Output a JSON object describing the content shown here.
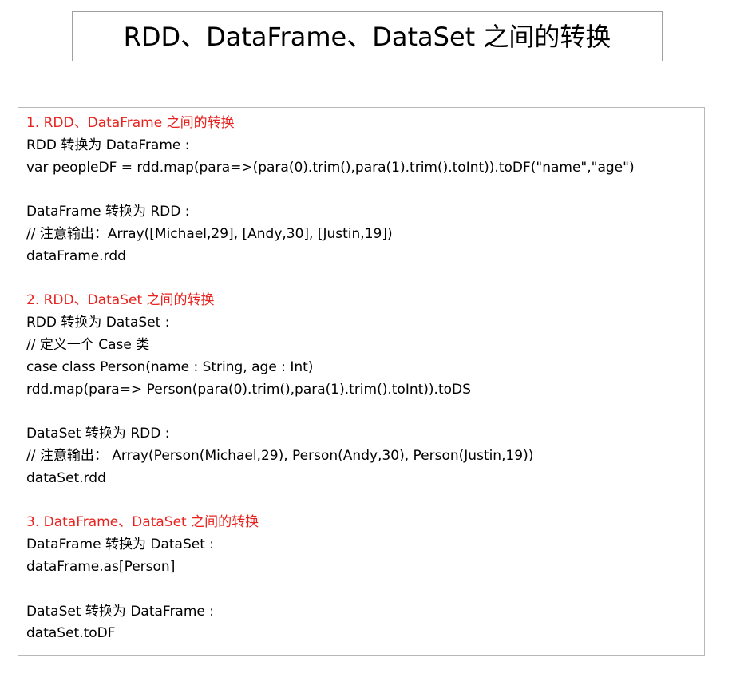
{
  "title": "RDD、DataFrame、DataSet 之间的转换",
  "accent_color": "#e8231f",
  "sections": [
    {
      "heading": "1. RDD、DataFrame 之间的转换",
      "lines": [
        "RDD 转换为 DataFrame :",
        "var peopleDF = rdd.map(para=>(para(0).trim(),para(1).trim().toInt)).toDF(\"name\",\"age\")",
        "",
        "DataFrame 转换为 RDD :",
        "//   注意输出：Array([Michael,29], [Andy,30], [Justin,19])",
        "dataFrame.rdd"
      ]
    },
    {
      "heading": "2. RDD、DataSet 之间的转换",
      "lines": [
        "RDD 转换为 DataSet :",
        "//   定义一个 Case 类",
        "case class Person(name : String, age : Int)",
        "rdd.map(para=> Person(para(0).trim(),para(1).trim().toInt)).toDS",
        "",
        "DataSet 转换为 RDD :",
        "//   注意输出：  Array(Person(Michael,29), Person(Andy,30), Person(Justin,19))",
        "dataSet.rdd"
      ]
    },
    {
      "heading": "3. DataFrame、DataSet 之间的转换",
      "lines": [
        "DataFrame 转换为 DataSet :",
        "dataFrame.as[Person]",
        "",
        "DataSet 转换为 DataFrame :",
        "dataSet.toDF"
      ]
    }
  ]
}
